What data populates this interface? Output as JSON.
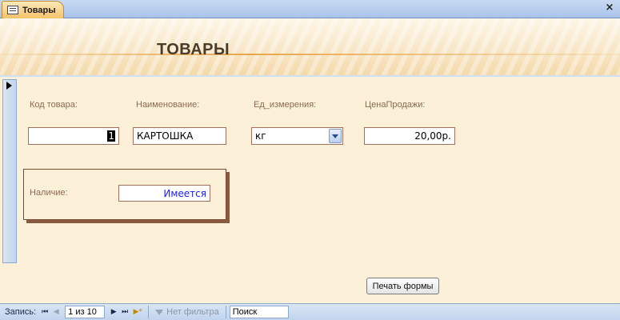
{
  "tab": {
    "title": "Товары",
    "icon": "form-icon"
  },
  "window": {
    "close_label": "×"
  },
  "form": {
    "title": "ТОВАРЫ"
  },
  "fields": {
    "code": {
      "label": "Код товара:",
      "value": "1"
    },
    "name": {
      "label": "Наименование:",
      "value": "КАРТОШКА"
    },
    "unit": {
      "label": "Ед_измерения:",
      "value": "кг"
    },
    "price": {
      "label": "ЦенаПродажи:",
      "value": "20,00р."
    },
    "availability": {
      "label": "Наличие:",
      "value": "Имеется"
    }
  },
  "buttons": {
    "print": "Печать формы"
  },
  "navigation": {
    "record_label": "Запись:",
    "current": "1 из 10",
    "filter_label": "Нет фильтра",
    "search_label": "Поиск",
    "first": "⏮",
    "prev": "◀",
    "next": "▶",
    "last": "⏭",
    "new": "▶*"
  },
  "colors": {
    "background": "#fdf0d8",
    "label": "#8a6a55",
    "availability_value": "#1a1aff",
    "field_border": "#a0705a"
  }
}
